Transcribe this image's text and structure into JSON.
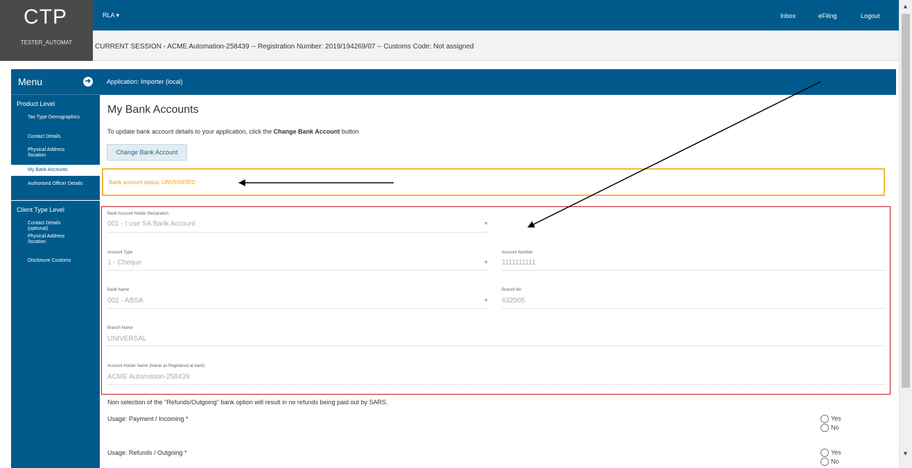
{
  "header": {
    "logo": "CTP",
    "user": "TESTER_AUTOMAT",
    "role_menu": "RLA",
    "links": [
      "Inbox",
      "eFiling",
      "Logout"
    ]
  },
  "session": {
    "text": "CURRENT SESSION - ACME Automation-258439 -- Registration Number: 2019/194269/07 -- Customs Code: Not assigned"
  },
  "sidebar": {
    "title": "Menu",
    "product_level": {
      "title": "Product Level",
      "items": [
        {
          "label": "Tax Type Demographics"
        },
        {
          "label": "Contact Details"
        },
        {
          "label": "Physical Address /location"
        },
        {
          "label": "My Bank Accounts"
        },
        {
          "label": "Authorised Officer Details"
        }
      ]
    },
    "client_type_level": {
      "title": "Client Type Level",
      "items": [
        {
          "label": "Contact Details (optional)"
        },
        {
          "label": "Physical Address /location"
        },
        {
          "label": "Disclosure Customs"
        }
      ]
    }
  },
  "app": {
    "title": "Application: Importer (local)"
  },
  "page": {
    "title": "My Bank Accounts",
    "instruction_pre": "To update bank account details to your application, click the ",
    "instruction_bold": "Change Bank Account",
    "instruction_post": " button",
    "change_button": "Change Bank Account",
    "status": "Bank account status: UNVERIFIED"
  },
  "form": {
    "holder_declaration": {
      "label": "Bank Account Holder Declaration",
      "value": "001 - I use SA Bank Account"
    },
    "account_type": {
      "label": "Account Type",
      "value": "1 - Cheque"
    },
    "account_number": {
      "label": "Account Number",
      "value": "1111111111"
    },
    "bank_name": {
      "label": "Bank Name",
      "value": "002 - ABSA"
    },
    "branch_no": {
      "label": "Branch No",
      "value": "632005"
    },
    "branch_name": {
      "label": "Branch Name",
      "value": "UNIVERSAL"
    },
    "holder_name": {
      "label": "Account Holder Name (Name as Registered at bank)",
      "value": "ACME Automation-258439"
    }
  },
  "usage": {
    "note": "Non selection of the \"Refunds/Outgoing\" bank option will result in no refunds being paid out by SARS.",
    "payment_label": "Usage: Payment / Incoming *",
    "refunds_label": "Usage: Refunds / Outgoing *",
    "yes": "Yes",
    "no": "No"
  },
  "colors": {
    "primary": "#005a8c",
    "warning": "#f4b73a",
    "highlight_border": "#c0161e"
  }
}
